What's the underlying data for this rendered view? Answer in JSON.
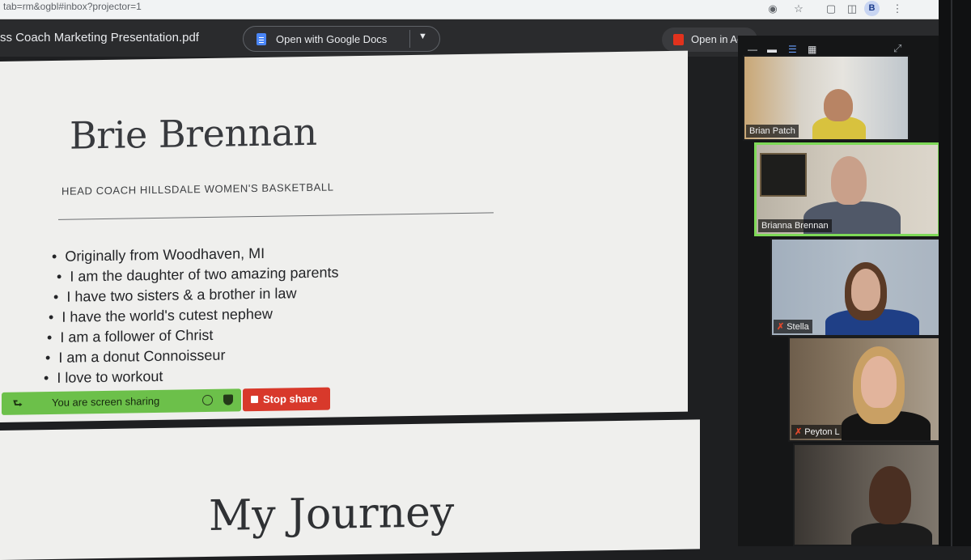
{
  "browser": {
    "url_fragment": "tab=rm&ogbl#inbox?projector=1",
    "profile_initial": "B"
  },
  "pdf_viewer": {
    "filename": "ss Coach Marketing Presentation.pdf",
    "open_with_label": "Open with Google Docs",
    "open_in_label": "Open in Ac"
  },
  "slide1": {
    "title": "Brie Brennan",
    "subtitle": "HEAD COACH HILLSDALE WOMEN'S BASKETBALL",
    "bullets": [
      "Originally from Woodhaven, MI",
      "I am the daughter of two amazing parents",
      "I have two sisters & a brother in law",
      "I have the world's cutest nephew",
      "I am a follower of Christ",
      "I am a donut Connoisseur",
      "I love to workout"
    ]
  },
  "share_bar": {
    "status_label": "You are screen sharing",
    "stop_label": "Stop share",
    "status_color": "#6cc04a",
    "stop_color": "#d8392b"
  },
  "slide2": {
    "title": "My Journey"
  },
  "participants": [
    {
      "name": "Brian Patch",
      "muted": false,
      "speaking": false
    },
    {
      "name": "Brianna Brennan",
      "muted": false,
      "speaking": true
    },
    {
      "name": "Stella",
      "muted": true,
      "speaking": false
    },
    {
      "name": "Peyton L",
      "muted": true,
      "speaking": false
    },
    {
      "name": "",
      "muted": false,
      "speaking": false
    }
  ],
  "colors": {
    "speaking_border": "#7ed957",
    "mute_icon": "#e0492d"
  }
}
